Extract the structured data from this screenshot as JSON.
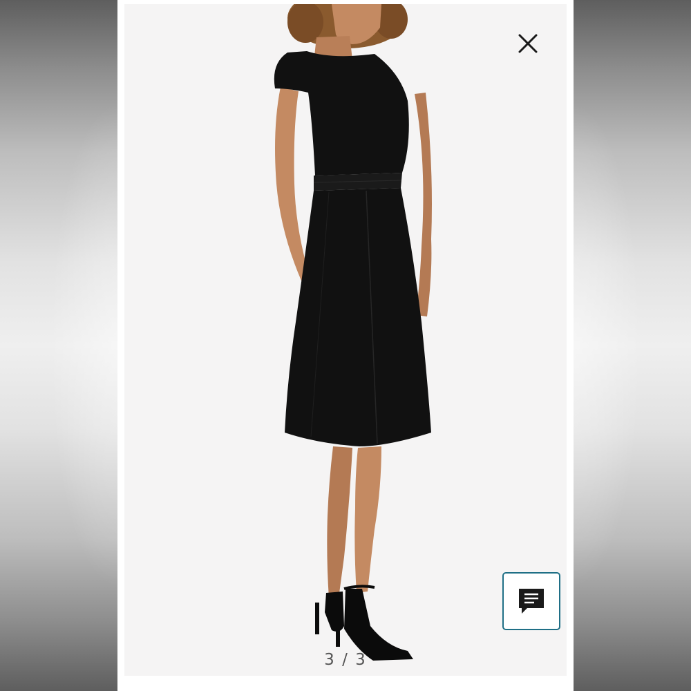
{
  "viewer": {
    "pager": {
      "current": "3",
      "separator": "/",
      "total": "3",
      "label": "3 / 3"
    },
    "close_icon": "close-icon",
    "chat_icon": "chat-icon"
  },
  "colors": {
    "photo_background": "#f5f4f4",
    "dress": "#111111",
    "chat_button_border": "#1f6f86"
  }
}
